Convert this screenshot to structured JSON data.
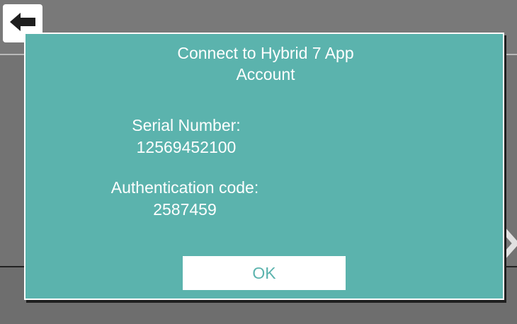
{
  "header": {
    "back_icon": "back-arrow-icon"
  },
  "side": {
    "next_icon": "chevron-right-icon"
  },
  "dialog": {
    "title_line1": "Connect to  Hybrid 7  App",
    "title_line2": "Account",
    "serial_label": "Serial Number:",
    "serial_value": "12569452100",
    "auth_label": "Authentication code:",
    "auth_value": "2587459",
    "ok_label": "OK"
  },
  "colors": {
    "dialog_bg": "#5bb3ad",
    "background": "#737373",
    "text": "#ffffff"
  }
}
